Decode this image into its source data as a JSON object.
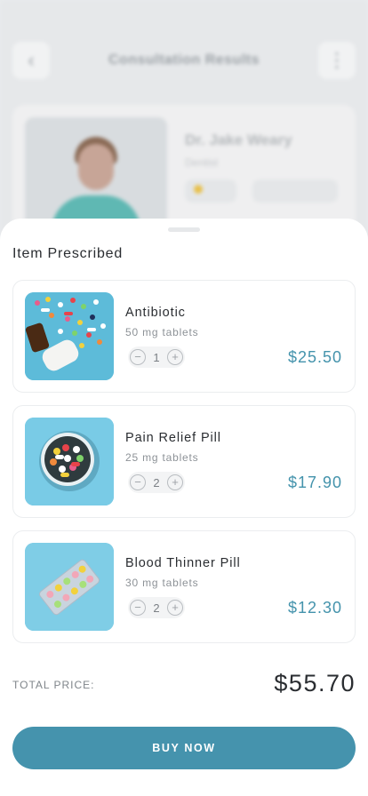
{
  "background": {
    "title": "Consultation Results",
    "doctor_name": "Dr. Jake Weary",
    "doctor_role": "Dentist"
  },
  "sheet": {
    "title": "Item Prescribed",
    "items": [
      {
        "name": "Antibiotic",
        "dose": "50 mg tablets",
        "qty": "1",
        "price": "$25.50"
      },
      {
        "name": "Pain Relief Pill",
        "dose": "25 mg tablets",
        "qty": "2",
        "price": "$17.90"
      },
      {
        "name": "Blood Thinner Pill",
        "dose": "30 mg tablets",
        "qty": "2",
        "price": "$12.30"
      }
    ],
    "minus_icon": "−",
    "plus_icon": "+",
    "total_label": "TOTAL PRICE:",
    "total_value": "$55.70",
    "buy_label": "BUY NOW"
  },
  "colors": {
    "accent": "#4593ad",
    "price": "#4493ac",
    "thumb_bg": "#6cc3df"
  },
  "icons": [
    "back-chevron-icon",
    "more-vertical-icon",
    "star-icon",
    "minus-icon",
    "plus-icon"
  ]
}
